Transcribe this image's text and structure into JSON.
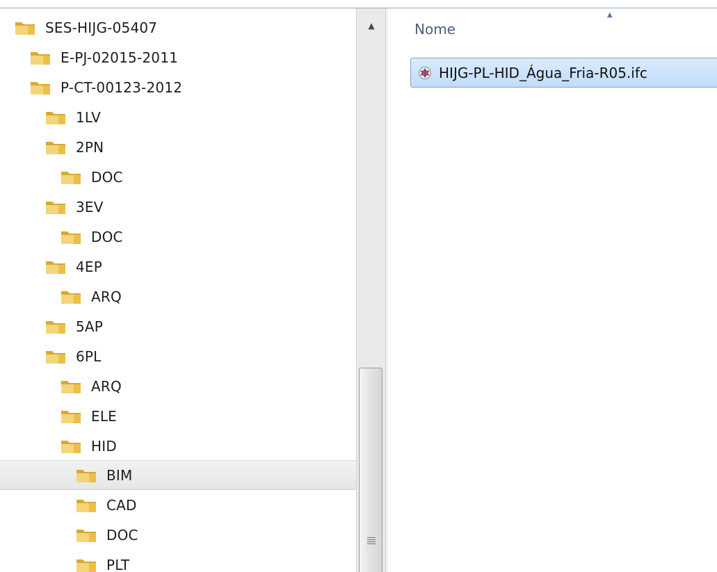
{
  "navigation_tree": {
    "items": [
      {
        "label": "SES-HIJG-05407",
        "icon": "folder-icon",
        "selected": false
      },
      {
        "label": "E-PJ-02015-2011",
        "icon": "folder-icon",
        "selected": false
      },
      {
        "label": "P-CT-00123-2012",
        "icon": "folder-icon",
        "selected": false
      },
      {
        "label": "1LV",
        "icon": "folder-icon",
        "selected": false
      },
      {
        "label": "2PN",
        "icon": "folder-icon",
        "selected": false
      },
      {
        "label": "DOC",
        "icon": "folder-icon",
        "selected": false
      },
      {
        "label": "3EV",
        "icon": "folder-icon",
        "selected": false
      },
      {
        "label": "DOC",
        "icon": "folder-icon",
        "selected": false
      },
      {
        "label": "4EP",
        "icon": "folder-icon",
        "selected": false
      },
      {
        "label": "ARQ",
        "icon": "folder-icon",
        "selected": false
      },
      {
        "label": "5AP",
        "icon": "folder-icon",
        "selected": false
      },
      {
        "label": "6PL",
        "icon": "folder-icon",
        "selected": false
      },
      {
        "label": "ARQ",
        "icon": "folder-icon",
        "selected": false
      },
      {
        "label": "ELE",
        "icon": "folder-icon",
        "selected": false
      },
      {
        "label": "HID",
        "icon": "folder-icon",
        "selected": false
      },
      {
        "label": "BIM",
        "icon": "folder-icon",
        "selected": true
      },
      {
        "label": "CAD",
        "icon": "folder-icon",
        "selected": false
      },
      {
        "label": "DOC",
        "icon": "folder-icon",
        "selected": false
      },
      {
        "label": "PLT",
        "icon": "folder-icon",
        "selected": false
      }
    ]
  },
  "file_list": {
    "column_header": "Nome",
    "sort_indicator_icon": "sort-ascending-icon",
    "files": [
      {
        "name": "HIJG-PL-HID_Água_Fria-R05.ifc",
        "icon": "ifc-file-icon",
        "selected": true
      }
    ]
  },
  "colors": {
    "selection_fill": "#cce1fa",
    "selection_border": "#7da2ce",
    "header_text": "#4c607a",
    "folder": "#e8c25a"
  }
}
